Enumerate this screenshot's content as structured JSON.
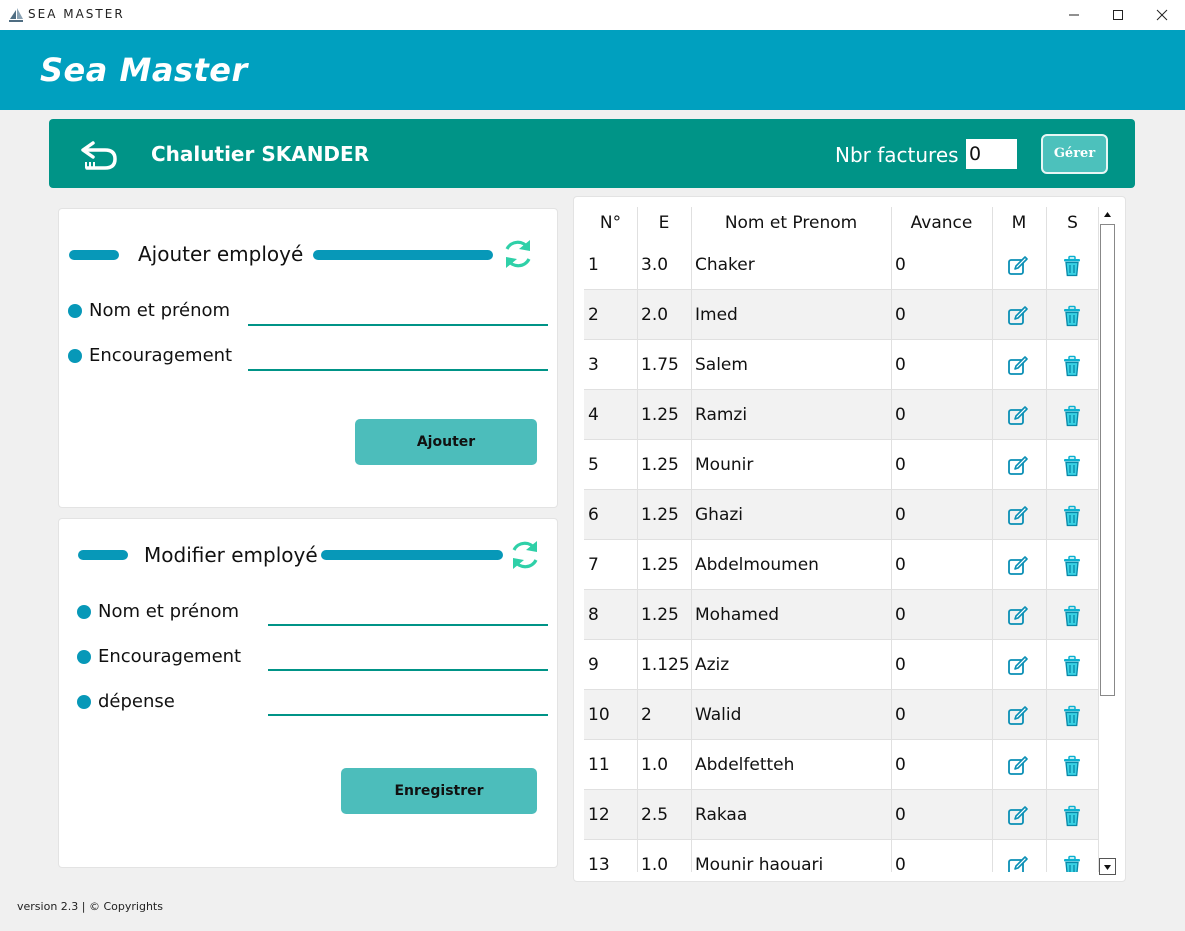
{
  "window": {
    "title": "SEA MASTER"
  },
  "header": {
    "brand": "Sea Master"
  },
  "toolbar": {
    "boat_name": "Chalutier SKANDER",
    "nbr_label": "Nbr factures",
    "nbr_value": "0",
    "gerer_label": "Gérer"
  },
  "add_panel": {
    "title": "Ajouter employé",
    "name_label": "Nom et prénom",
    "enc_label": "Encouragement",
    "button_label": "Ajouter"
  },
  "mod_panel": {
    "title": "Modifier employé",
    "name_label": "Nom et prénom",
    "enc_label": "Encouragement",
    "dep_label": "dépense",
    "button_label": "Enregistrer"
  },
  "table": {
    "headers": [
      "N°",
      "E",
      "Nom et Prenom",
      "Avance",
      "M",
      "S"
    ],
    "rows": [
      {
        "n": "1",
        "e": "3.0",
        "name": "Chaker",
        "avance": "0"
      },
      {
        "n": "2",
        "e": "2.0",
        "name": "Imed",
        "avance": "0"
      },
      {
        "n": "3",
        "e": "1.75",
        "name": "Salem",
        "avance": "0"
      },
      {
        "n": "4",
        "e": "1.25",
        "name": "Ramzi",
        "avance": "0"
      },
      {
        "n": "5",
        "e": "1.25",
        "name": "Mounir",
        "avance": "0"
      },
      {
        "n": "6",
        "e": "1.25",
        "name": "Ghazi",
        "avance": "0"
      },
      {
        "n": "7",
        "e": "1.25",
        "name": "Abdelmoumen",
        "avance": "0"
      },
      {
        "n": "8",
        "e": "1.25",
        "name": "Mohamed",
        "avance": "0"
      },
      {
        "n": "9",
        "e": "1.125",
        "name": "Aziz",
        "avance": "0"
      },
      {
        "n": "10",
        "e": "2",
        "name": "Walid",
        "avance": "0"
      },
      {
        "n": "11",
        "e": "1.0",
        "name": "Abdelfetteh",
        "avance": "0"
      },
      {
        "n": "12",
        "e": "2.5",
        "name": "Rakaa",
        "avance": "0"
      },
      {
        "n": "13",
        "e": "1.0",
        "name": "Mounir haouari",
        "avance": "0"
      }
    ]
  },
  "footer": {
    "text": "version 2.3 | © Copyrights"
  },
  "colors": {
    "header": "#00a0bf",
    "toolbar": "#009487",
    "accent": "#0798b8",
    "button": "#4cbdbb",
    "refresh": "#2fd0a8",
    "edit": "#0a8fb5",
    "delete": "#0ab0cf"
  },
  "icons": {
    "back": "undo-arrow-icon",
    "refresh": "refresh-icon",
    "edit": "edit-icon",
    "delete": "trash-icon"
  }
}
